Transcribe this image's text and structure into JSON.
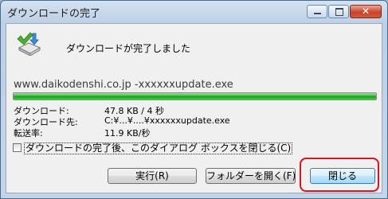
{
  "window": {
    "title": "ダウンロードの完了",
    "minimize_label": "",
    "maximize_label": "",
    "close_label": "✕"
  },
  "status": {
    "message": "ダウンロードが完了しました",
    "source": "www.daikodenshi.co.jp -xxxxxxupdate.exe",
    "progress_fraction": 1.0
  },
  "details": [
    {
      "label": "ダウンロード:",
      "value": "47.8 KB / 4 秒"
    },
    {
      "label": "ダウンロード先:",
      "value": "C:¥...¥....¥xxxxxxupdate.exe"
    },
    {
      "label": "転送率:",
      "value": "11.9 KB/秒"
    }
  ],
  "options": {
    "close_on_complete_label": "ダウンロードの完了後、このダイアログ ボックスを閉じる(C)",
    "close_on_complete_checked": false
  },
  "buttons": {
    "run_label": "実行(R)",
    "open_folder_label": "フォルダーを開く(F)",
    "close_label": "閉じる"
  },
  "colors": {
    "progress": "#11a011",
    "highlight": "#e0101c"
  },
  "icons": {
    "download_complete": "download-complete-icon"
  }
}
